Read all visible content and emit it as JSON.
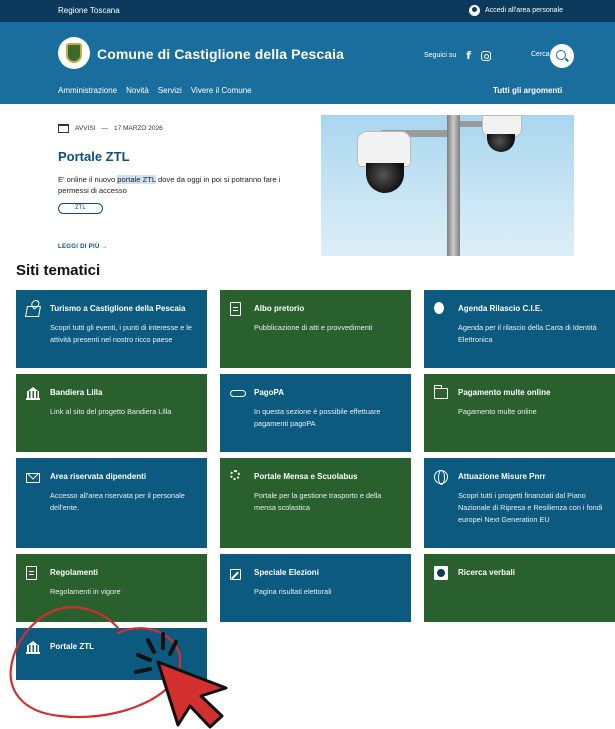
{
  "topbar": {
    "region": "Regione Toscana",
    "login_label": "Accedi all'area personale"
  },
  "header": {
    "site_title": "Comune di Castiglione della Pescaia",
    "follow_label": "Seguici su",
    "social_icons": [
      "facebook-icon",
      "instagram-icon"
    ],
    "search_label": "Cerca",
    "nav": [
      "Amministrazione",
      "Novità",
      "Servizi",
      "Vivere il Comune"
    ],
    "nav_right": "Tutti gli argomenti"
  },
  "news": {
    "category": "AVVISI",
    "separator": "—",
    "date": "17 MARZO 2026",
    "title": "Portale ZTL",
    "desc_before": "E' online il nuovo ",
    "desc_highlight": "portale ZTL",
    "desc_after": " dove da oggi in poi si potranno fare i permessi di accesso",
    "tag": "ZTL",
    "read_more": "LEGGI DI PIÙ →"
  },
  "section_title": "Siti tematici",
  "colors": {
    "blue_tile": "#0d5a80",
    "green_tile": "#2a5f2e",
    "header": "#1a6e9e",
    "topbar": "#0b3a5c",
    "annotation": "#d32f2f"
  },
  "tiles": [
    {
      "title": "Turismo a Castiglione della Pescaia",
      "desc": "Scopri tutti gli eventi, i punti di interesse e le attività presenti nel nostro ricco paese",
      "icon": "map-icon",
      "color": "blue"
    },
    {
      "title": "Albo pretorio",
      "desc": "Pubblicazione di atti e provvedimenti",
      "icon": "document-icon",
      "color": "green"
    },
    {
      "title": "Agenda Rilascio C.I.E.",
      "desc": "Agenda per il rilascio della Carta di Identità Elettronica",
      "icon": "id-card-icon",
      "color": "blue"
    },
    {
      "title": "Bandiera Lilla",
      "desc": "Link al sito del progetto Bandiera Lilla",
      "icon": "building-icon",
      "color": "green"
    },
    {
      "title": "PagoPA",
      "desc": "In questa sezione è possibile effettuare pagamenti pagoPA",
      "icon": "pagopa-icon",
      "color": "blue"
    },
    {
      "title": "Pagamento multe online",
      "desc": "Pagamento multe online",
      "icon": "folder-icon",
      "color": "green"
    },
    {
      "title": "Area riservata dipendenti",
      "desc": "Accesso all'area riservata per il personale dell'ente.",
      "icon": "mail-icon",
      "color": "blue"
    },
    {
      "title": "Portale Mensa e Scuolabus",
      "desc": "Portale per la gestione trasporto e della mensa scolastica",
      "icon": "gear-icon",
      "color": "green"
    },
    {
      "title": "Attuazione Misure Pnrr",
      "desc": "Scopri tutti i progetti finanziati dal Piano Nazionale di Ripresa e Resilienza con i fondi europei Next Generation EU",
      "icon": "globe-icon",
      "color": "blue"
    },
    {
      "title": "Regolamenti",
      "desc": "Regolamenti in vigore",
      "icon": "document-icon",
      "color": "green"
    },
    {
      "title": "Speciale Elezioni",
      "desc": "Pagina risultati elettorali",
      "icon": "pencil-icon",
      "color": "blue"
    },
    {
      "title": "Ricerca verbali",
      "desc": "",
      "icon": "badge-icon",
      "color": "green"
    },
    {
      "title": "Portale ZTL",
      "desc": "",
      "icon": "building-icon",
      "color": "blue"
    }
  ]
}
